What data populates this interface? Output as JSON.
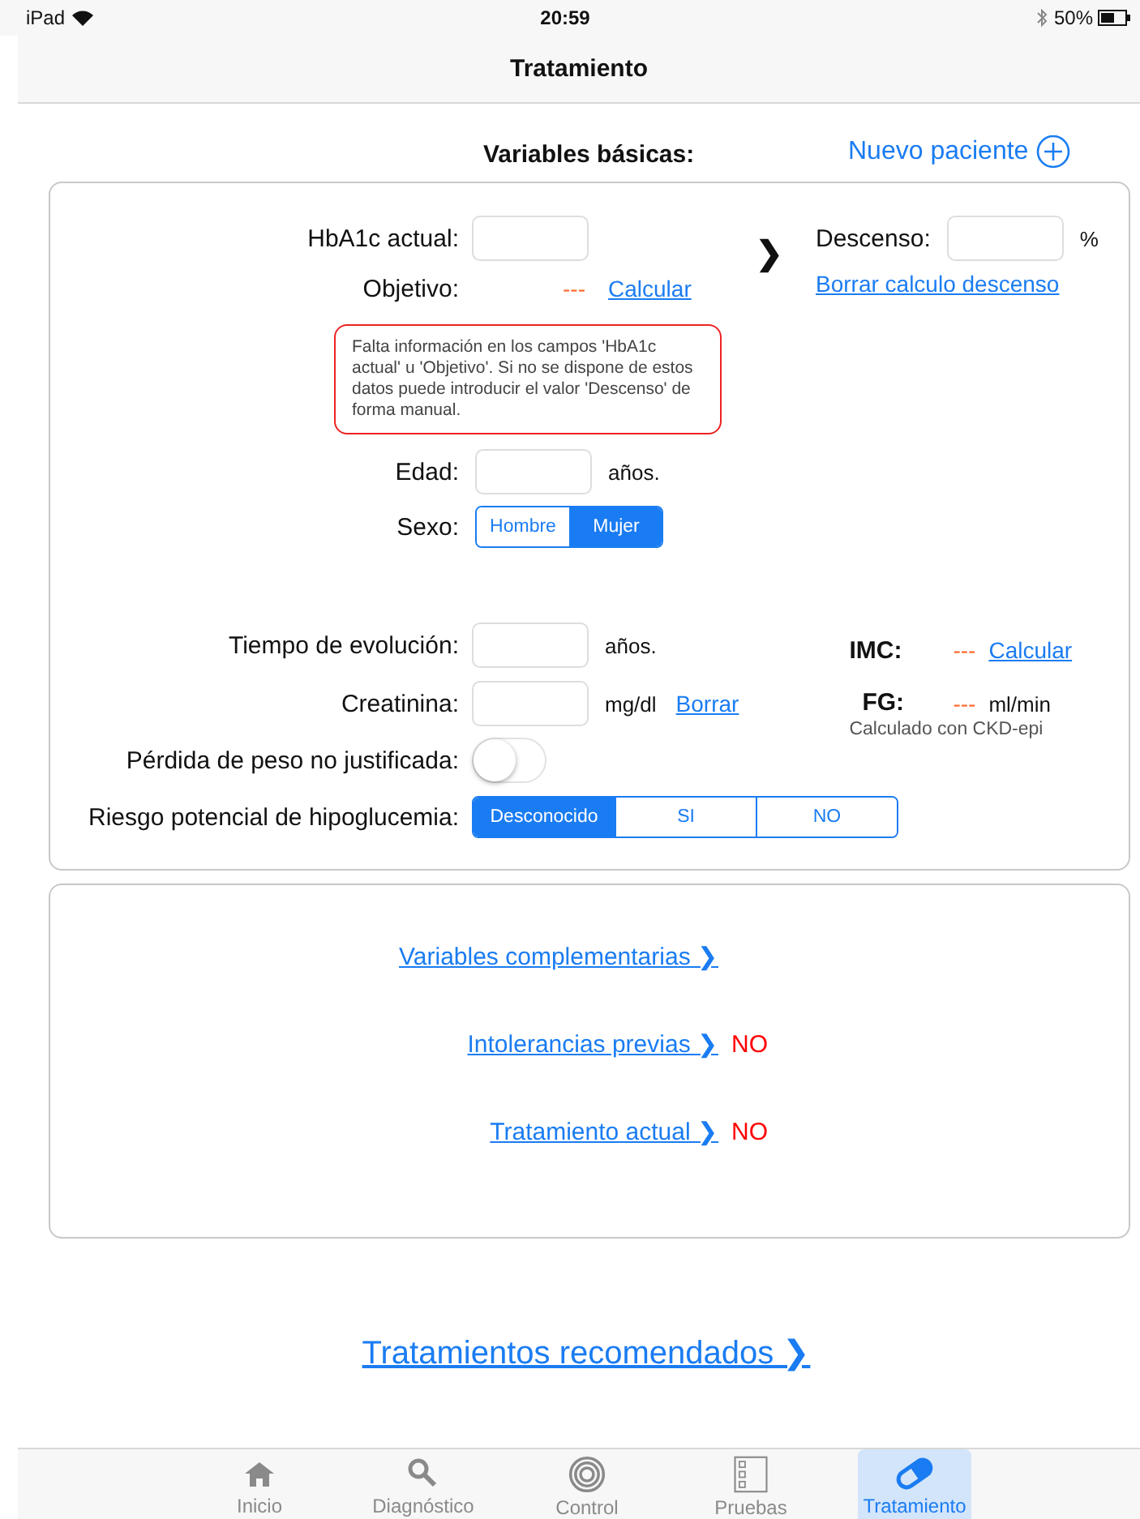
{
  "status_bar": {
    "device": "iPad",
    "time": "20:59",
    "battery": "50%"
  },
  "nav": {
    "title": "Tratamiento"
  },
  "header": {
    "title": "Variables básicas:",
    "new_patient": "Nuevo paciente"
  },
  "basic": {
    "hba1c": {
      "label": "HbA1c actual:"
    },
    "objetivo": {
      "label": "Objetivo:",
      "value": "---",
      "link": "Calcular"
    },
    "warning": "Falta información en los campos 'HbA1c actual' u 'Objetivo'. Si no se dispone de estos datos puede introducir el valor 'Descenso' de forma manual.",
    "edad": {
      "label": "Edad:",
      "unit": "años."
    },
    "sexo": {
      "label": "Sexo:",
      "options": [
        {
          "label": "Hombre",
          "selected": false
        },
        {
          "label": "Mujer",
          "selected": true
        }
      ]
    },
    "chevron": "❯",
    "descenso": {
      "label": "Descenso:",
      "unit": "%",
      "link": "Borrar calculo descenso"
    },
    "tiempo": {
      "label": "Tiempo de evolución:",
      "unit": "años."
    },
    "creatinina": {
      "label": "Creatinina:",
      "unit": "mg/dl",
      "link": "Borrar"
    },
    "perdida": {
      "label": "Pérdida de peso no justificada:",
      "on": false
    },
    "riesgo": {
      "label": "Riesgo potencial de hipoglucemia:",
      "options": [
        {
          "label": "Desconocido",
          "selected": true
        },
        {
          "label": "SI",
          "selected": false
        },
        {
          "label": "NO",
          "selected": false
        }
      ]
    },
    "imc": {
      "label": "IMC:",
      "value": "---",
      "link": "Calcular"
    },
    "fg": {
      "label": "FG:",
      "value": "---",
      "unit": "ml/min",
      "note": "Calculado con CKD-epi"
    }
  },
  "more": [
    {
      "link": "Variables complementarias ❯"
    },
    {
      "link": "Intolerancias previas ❯",
      "value": "NO"
    },
    {
      "link": "Tratamiento actual ❯",
      "value": "NO"
    }
  ],
  "recommended": "Tratamientos recomendados ❯",
  "tabs": [
    {
      "label": "Inicio",
      "selected": false
    },
    {
      "label": "Diagnóstico",
      "selected": false
    },
    {
      "label": "Control",
      "selected": false
    },
    {
      "label": "Pruebas",
      "selected": false
    },
    {
      "label": "Tratamiento",
      "selected": true
    }
  ]
}
